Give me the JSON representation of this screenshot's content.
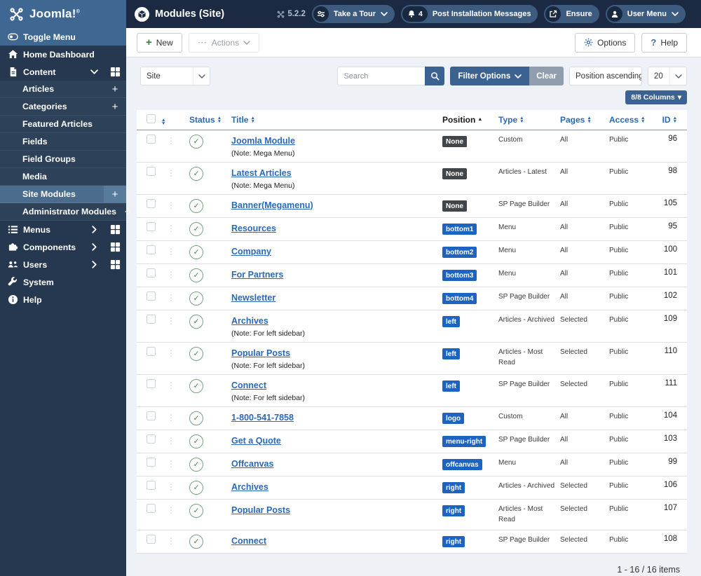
{
  "topbar": {
    "brand": "Joomla!",
    "brand_sup": "®",
    "page_title": "Modules (Site)",
    "version": "5.2.2",
    "tour_label": "Take a Tour",
    "messages_label": "Post Installation Messages",
    "messages_badge": "4",
    "ensure_label": "Ensure",
    "user_menu_label": "User Menu"
  },
  "sidebar": {
    "items": [
      {
        "label": "Toggle Menu",
        "icon": "toggle",
        "toggle": true
      },
      {
        "label": "Home Dashboard",
        "icon": "home"
      },
      {
        "label": "Content",
        "icon": "file",
        "chevron": "down",
        "grid": true
      },
      {
        "label": "Articles",
        "sub": true,
        "plus": true
      },
      {
        "label": "Categories",
        "sub": true,
        "plus": true
      },
      {
        "label": "Featured Articles",
        "sub": true
      },
      {
        "label": "Fields",
        "sub": true
      },
      {
        "label": "Field Groups",
        "sub": true
      },
      {
        "label": "Media",
        "sub": true
      },
      {
        "label": "Site Modules",
        "sub": true,
        "plus": true,
        "active": true
      },
      {
        "label": "Administrator Modules",
        "sub": true,
        "plus": true
      },
      {
        "label": "Menus",
        "icon": "list",
        "chevron": "right",
        "grid": true
      },
      {
        "label": "Components",
        "icon": "puzzle",
        "chevron": "right",
        "grid": true
      },
      {
        "label": "Users",
        "icon": "users",
        "chevron": "right",
        "grid": true
      },
      {
        "label": "System",
        "icon": "wrench"
      },
      {
        "label": "Help",
        "icon": "info"
      }
    ]
  },
  "toolbar": {
    "new_label": "New",
    "actions_label": "Actions",
    "options_label": "Options",
    "help_label": "Help"
  },
  "filters": {
    "client": "Site",
    "search_placeholder": "Search",
    "filter_options_label": "Filter Options",
    "clear_label": "Clear",
    "sort_value": "Position ascending",
    "page_size": "20",
    "columns_label": "8/8 Columns"
  },
  "table": {
    "headers": {
      "status": "Status",
      "title": "Title",
      "position": "Position",
      "type": "Type",
      "pages": "Pages",
      "access": "Access",
      "id": "ID"
    },
    "rows": [
      {
        "title": "Joomla Module",
        "note": "(Note: Mega Menu)",
        "position": "None",
        "style": "dark",
        "type": "Custom",
        "pages": "All",
        "access": "Public",
        "id": "96"
      },
      {
        "title": "Latest Articles",
        "note": "(Note: Mega Menu)",
        "position": "None",
        "style": "dark",
        "type": "Articles - Latest",
        "pages": "All",
        "access": "Public",
        "id": "98"
      },
      {
        "title": "Banner(Megamenu)",
        "note": "",
        "position": "None",
        "style": "dark",
        "type": "SP Page Builder",
        "pages": "All",
        "access": "Public",
        "id": "105"
      },
      {
        "title": "Resources",
        "note": "",
        "position": "bottom1",
        "style": "blue",
        "type": "Menu",
        "pages": "All",
        "access": "Public",
        "id": "95"
      },
      {
        "title": "Company",
        "note": "",
        "position": "bottom2",
        "style": "blue",
        "type": "Menu",
        "pages": "All",
        "access": "Public",
        "id": "100"
      },
      {
        "title": "For Partners",
        "note": "",
        "position": "bottom3",
        "style": "blue",
        "type": "Menu",
        "pages": "All",
        "access": "Public",
        "id": "101"
      },
      {
        "title": "Newsletter",
        "note": "",
        "position": "bottom4",
        "style": "blue",
        "type": "SP Page Builder",
        "pages": "All",
        "access": "Public",
        "id": "102"
      },
      {
        "title": "Archives",
        "note": "(Note: For left sidebar)",
        "position": "left",
        "style": "blue",
        "type": "Articles - Archived",
        "pages": "Selected",
        "access": "Public",
        "id": "109"
      },
      {
        "title": "Popular Posts",
        "note": "(Note: For left sidebar)",
        "position": "left",
        "style": "blue",
        "type": "Articles - Most Read",
        "pages": "Selected",
        "access": "Public",
        "id": "110"
      },
      {
        "title": "Connect",
        "note": "(Note: For left sidebar)",
        "position": "left",
        "style": "blue",
        "type": "SP Page Builder",
        "pages": "Selected",
        "access": "Public",
        "id": "111"
      },
      {
        "title": "1-800-541-7858",
        "note": "",
        "position": "logo",
        "style": "blue",
        "type": "Custom",
        "pages": "All",
        "access": "Public",
        "id": "104"
      },
      {
        "title": "Get a Quote",
        "note": "",
        "position": "menu-right",
        "style": "blue",
        "type": "SP Page Builder",
        "pages": "All",
        "access": "Public",
        "id": "103"
      },
      {
        "title": "Offcanvas",
        "note": "",
        "position": "offcanvas",
        "style": "blue",
        "type": "Menu",
        "pages": "All",
        "access": "Public",
        "id": "99"
      },
      {
        "title": "Archives",
        "note": "",
        "position": "right",
        "style": "blue",
        "type": "Articles - Archived",
        "pages": "Selected",
        "access": "Public",
        "id": "106"
      },
      {
        "title": "Popular Posts",
        "note": "",
        "position": "right",
        "style": "blue",
        "type": "Articles - Most Read",
        "pages": "Selected",
        "access": "Public",
        "id": "107"
      },
      {
        "title": "Connect",
        "note": "",
        "position": "right",
        "style": "blue",
        "type": "SP Page Builder",
        "pages": "Selected",
        "access": "Public",
        "id": "108"
      }
    ]
  },
  "footer": {
    "count": "1 - 16 / 16 items"
  },
  "icons": {
    "plus": "+",
    "ellipsis": "⋯",
    "question": "?",
    "check": "✓",
    "dots": "⋮",
    "sort_asc": "▲",
    "sort_desc": "▼",
    "caret_down": "▾"
  },
  "colors": {
    "accent_blue": "#2a69b8",
    "topbar_bg": "#1b2a42",
    "brand_bg": "#3e6791",
    "sidebar_bg": "#263850",
    "sidebar_active_bg": "#4c6c8d",
    "badge_dark": "#41464b",
    "badge_blue": "#1d64c0",
    "primary_button": "#3c6291",
    "clear_button": "#8f9dac",
    "content_bg": "#eef1f6",
    "success_green": "#2f8339"
  }
}
